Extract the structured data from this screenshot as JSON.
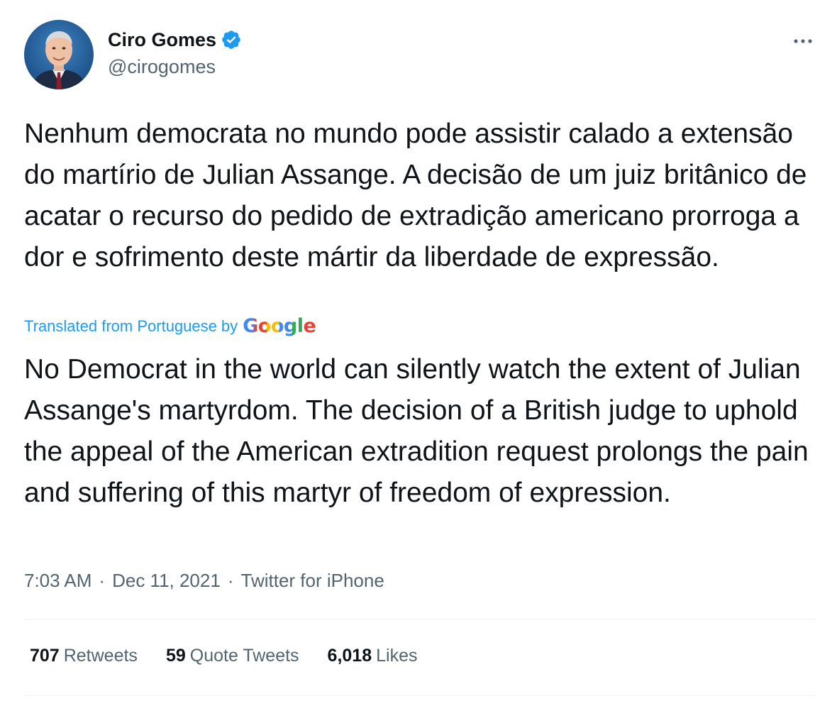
{
  "author": {
    "display_name": "Ciro Gomes",
    "handle": "@cirogomes",
    "verified_icon": "verified-badge-icon",
    "avatar_icon": "avatar"
  },
  "more_icon": "more-icon",
  "tweet": {
    "text": "Nenhum democrata no mundo pode assistir calado a extensão do martírio de Julian Assange. A decisão de um juiz britânico de acatar o recurso do pedido de extradição americano prorroga a dor e sofrimento deste mártir da liberdade de expressão.",
    "translation_label": "Translated from Portuguese",
    "translation_by": "by",
    "translation_provider": "Google",
    "translation": "No Democrat in the world can silently watch the extent of Julian Assange's martyrdom. The decision of a British judge to uphold the appeal of the American extradition request prolongs the pain and suffering of this martyr of freedom of expression."
  },
  "meta": {
    "time": "7:03 AM",
    "separator": "·",
    "date": "Dec 11, 2021",
    "source": "Twitter for iPhone"
  },
  "stats": {
    "retweets_count": "707",
    "retweets_label": "Retweets",
    "quotes_count": "59",
    "quotes_label": "Quote Tweets",
    "likes_count": "6,018",
    "likes_label": "Likes"
  },
  "colors": {
    "accent": "#1d9bf0",
    "text": "#0f1419",
    "secondary": "#536471",
    "divider": "#eff3f4",
    "google_blue": "#4285f4",
    "google_red": "#ea4335",
    "google_yellow": "#fbbc05",
    "google_green": "#34a853"
  }
}
